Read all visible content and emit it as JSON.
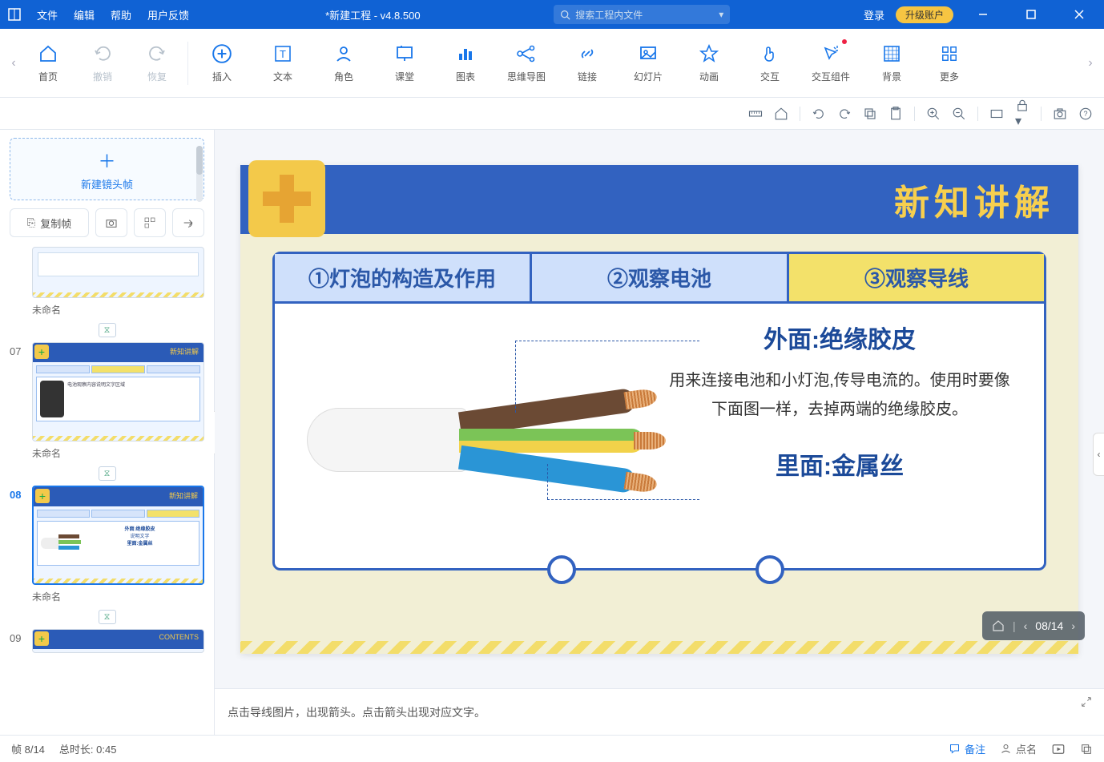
{
  "titlebar": {
    "menus": [
      "文件",
      "编辑",
      "帮助",
      "用户反馈"
    ],
    "title": "*新建工程 - v4.8.500",
    "search_placeholder": "搜索工程内文件",
    "login": "登录",
    "upgrade": "升级账户"
  },
  "toolbar": {
    "home": "首页",
    "undo": "撤销",
    "redo": "恢复",
    "insert": "插入",
    "text": "文本",
    "role": "角色",
    "class": "课堂",
    "chart": "图表",
    "mindmap": "思维导图",
    "link": "链接",
    "slideshow": "幻灯片",
    "animation": "动画",
    "interaction": "交互",
    "interaction_widget": "交互组件",
    "background": "背景",
    "more": "更多"
  },
  "left_panel": {
    "new_frame": "新建镜头帧",
    "copy_frame": "复制帧",
    "slides": [
      {
        "num": "",
        "name": "未命名"
      },
      {
        "num": "07",
        "name": "未命名"
      },
      {
        "num": "08",
        "name": "未命名"
      },
      {
        "num": "09",
        "name": ""
      }
    ],
    "thumb_title": "新知讲解",
    "thumb_contents": "CONTENTS"
  },
  "slide": {
    "title": "新知讲解",
    "tabs": [
      "①灯泡的构造及作用",
      "②观察电池",
      "③观察导线"
    ],
    "outer_label": "外面:绝缘胶皮",
    "desc": "用来连接电池和小灯泡,传导电流的。使用时要像下面图一样，去掉两端的绝缘胶皮。",
    "inner_label": "里面:金属丝"
  },
  "page_indicator": "08/14",
  "notes": "点击导线图片，出现箭头。点击箭头出现对应文字。",
  "status": {
    "frame": "帧 8/14",
    "duration": "总时长: 0:45",
    "remark": "备注",
    "roll": "点名"
  }
}
